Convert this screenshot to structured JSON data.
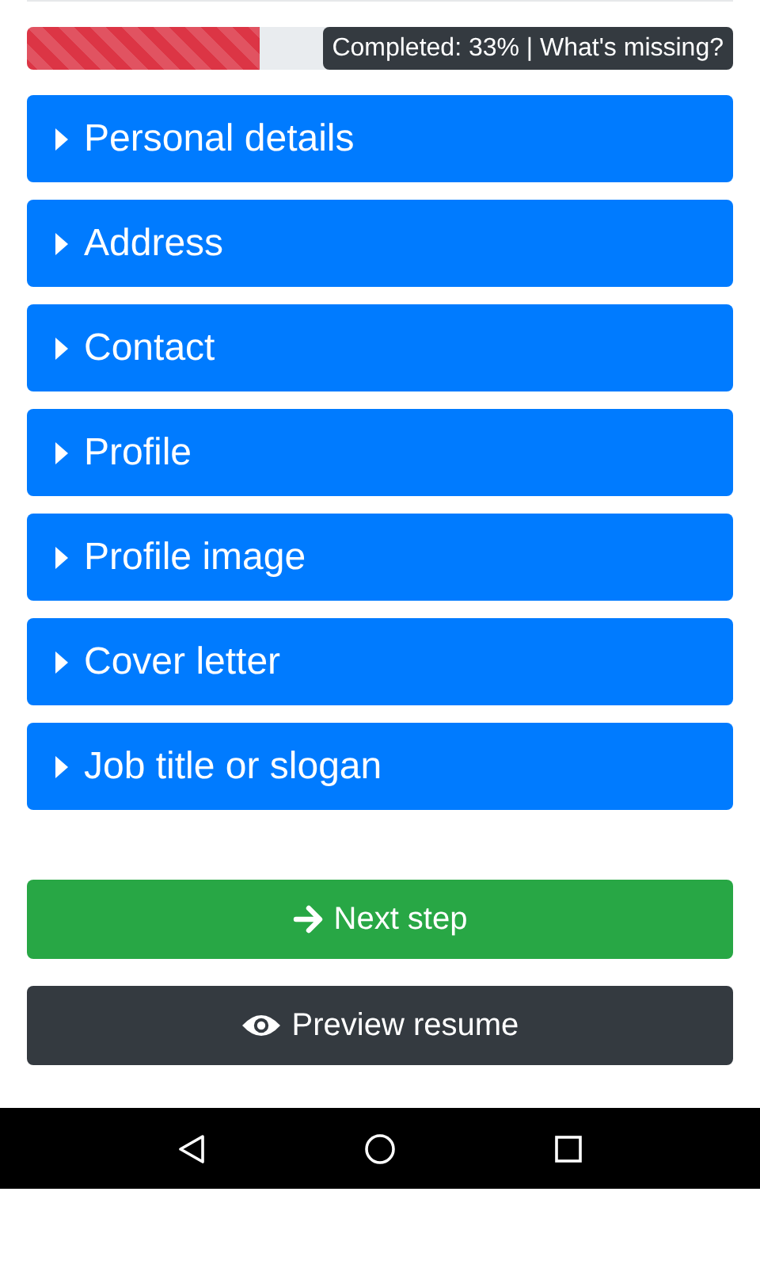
{
  "progress": {
    "level": 0.33,
    "label": "Completed: 33% | What's missing?"
  },
  "sections": [
    {
      "title": "Personal details",
      "expanded": false
    },
    {
      "title": "Address",
      "expanded": false
    },
    {
      "title": "Contact",
      "expanded": false
    },
    {
      "title": "Profile",
      "expanded": false
    },
    {
      "title": "Profile image",
      "expanded": false
    },
    {
      "title": "Cover letter",
      "expanded": false
    },
    {
      "title": "Job title or slogan",
      "expanded": false
    }
  ],
  "actions": [
    {
      "kind": "next",
      "label": "Next step"
    },
    {
      "kind": "preview",
      "label": "Preview resume"
    }
  ]
}
